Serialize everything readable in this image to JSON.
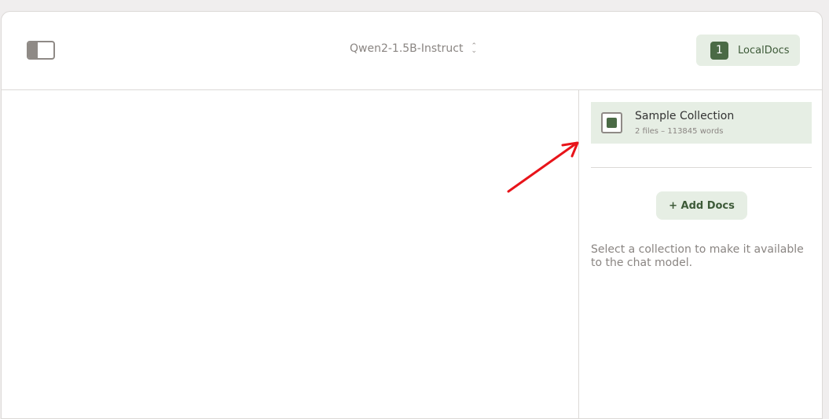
{
  "header": {
    "model_name": "Qwen2-1.5B-Instruct",
    "localdocs": {
      "count": "1",
      "label": "LocalDocs"
    }
  },
  "right_panel": {
    "collection": {
      "name": "Sample Collection",
      "meta": "2 files – 113845 words",
      "checked": true
    },
    "add_docs_label": "+ Add Docs",
    "hint": "Select a collection to make it available to the chat model."
  },
  "colors": {
    "accent_green": "#4a6a45",
    "accent_bg": "#e6eee4",
    "annotation_arrow": "#e8141a"
  }
}
